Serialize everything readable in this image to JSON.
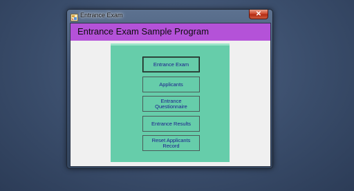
{
  "window": {
    "title": "Entrance Exam",
    "close_label": "✕"
  },
  "header": {
    "title": "Entrance Exam Sample Program",
    "color": "#b452d8"
  },
  "menu": {
    "panel_color": "#66cdaa",
    "buttons": [
      {
        "label": "Entrance Exam"
      },
      {
        "label": "Applicants"
      },
      {
        "label": "Entrance Questionnaire"
      },
      {
        "label": "Entrance Results"
      },
      {
        "label": "Reset Applicants Record"
      }
    ]
  }
}
